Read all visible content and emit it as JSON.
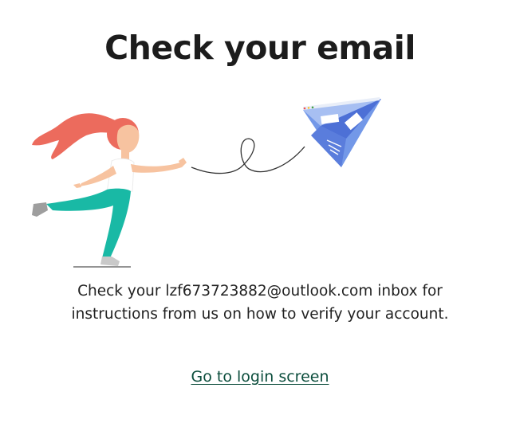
{
  "page": {
    "title": "Check your email"
  },
  "message": {
    "prefix": "Check your",
    "email": "lzf673723882@outlook.com",
    "suffix_line1": "inbox for",
    "line2": "instructions from us on how to verify your account."
  },
  "actions": {
    "login_link_label": "Go to login screen"
  },
  "illustration": {
    "icons": [
      "woman-throwing-icon",
      "paper-plane-icon"
    ],
    "colors": {
      "hair": "#ec6b5d",
      "skin": "#f7c3a0",
      "pants": "#19b9a5",
      "plane": "#7398e8",
      "plane_dark": "#4d70d6",
      "string": "#333333"
    }
  }
}
